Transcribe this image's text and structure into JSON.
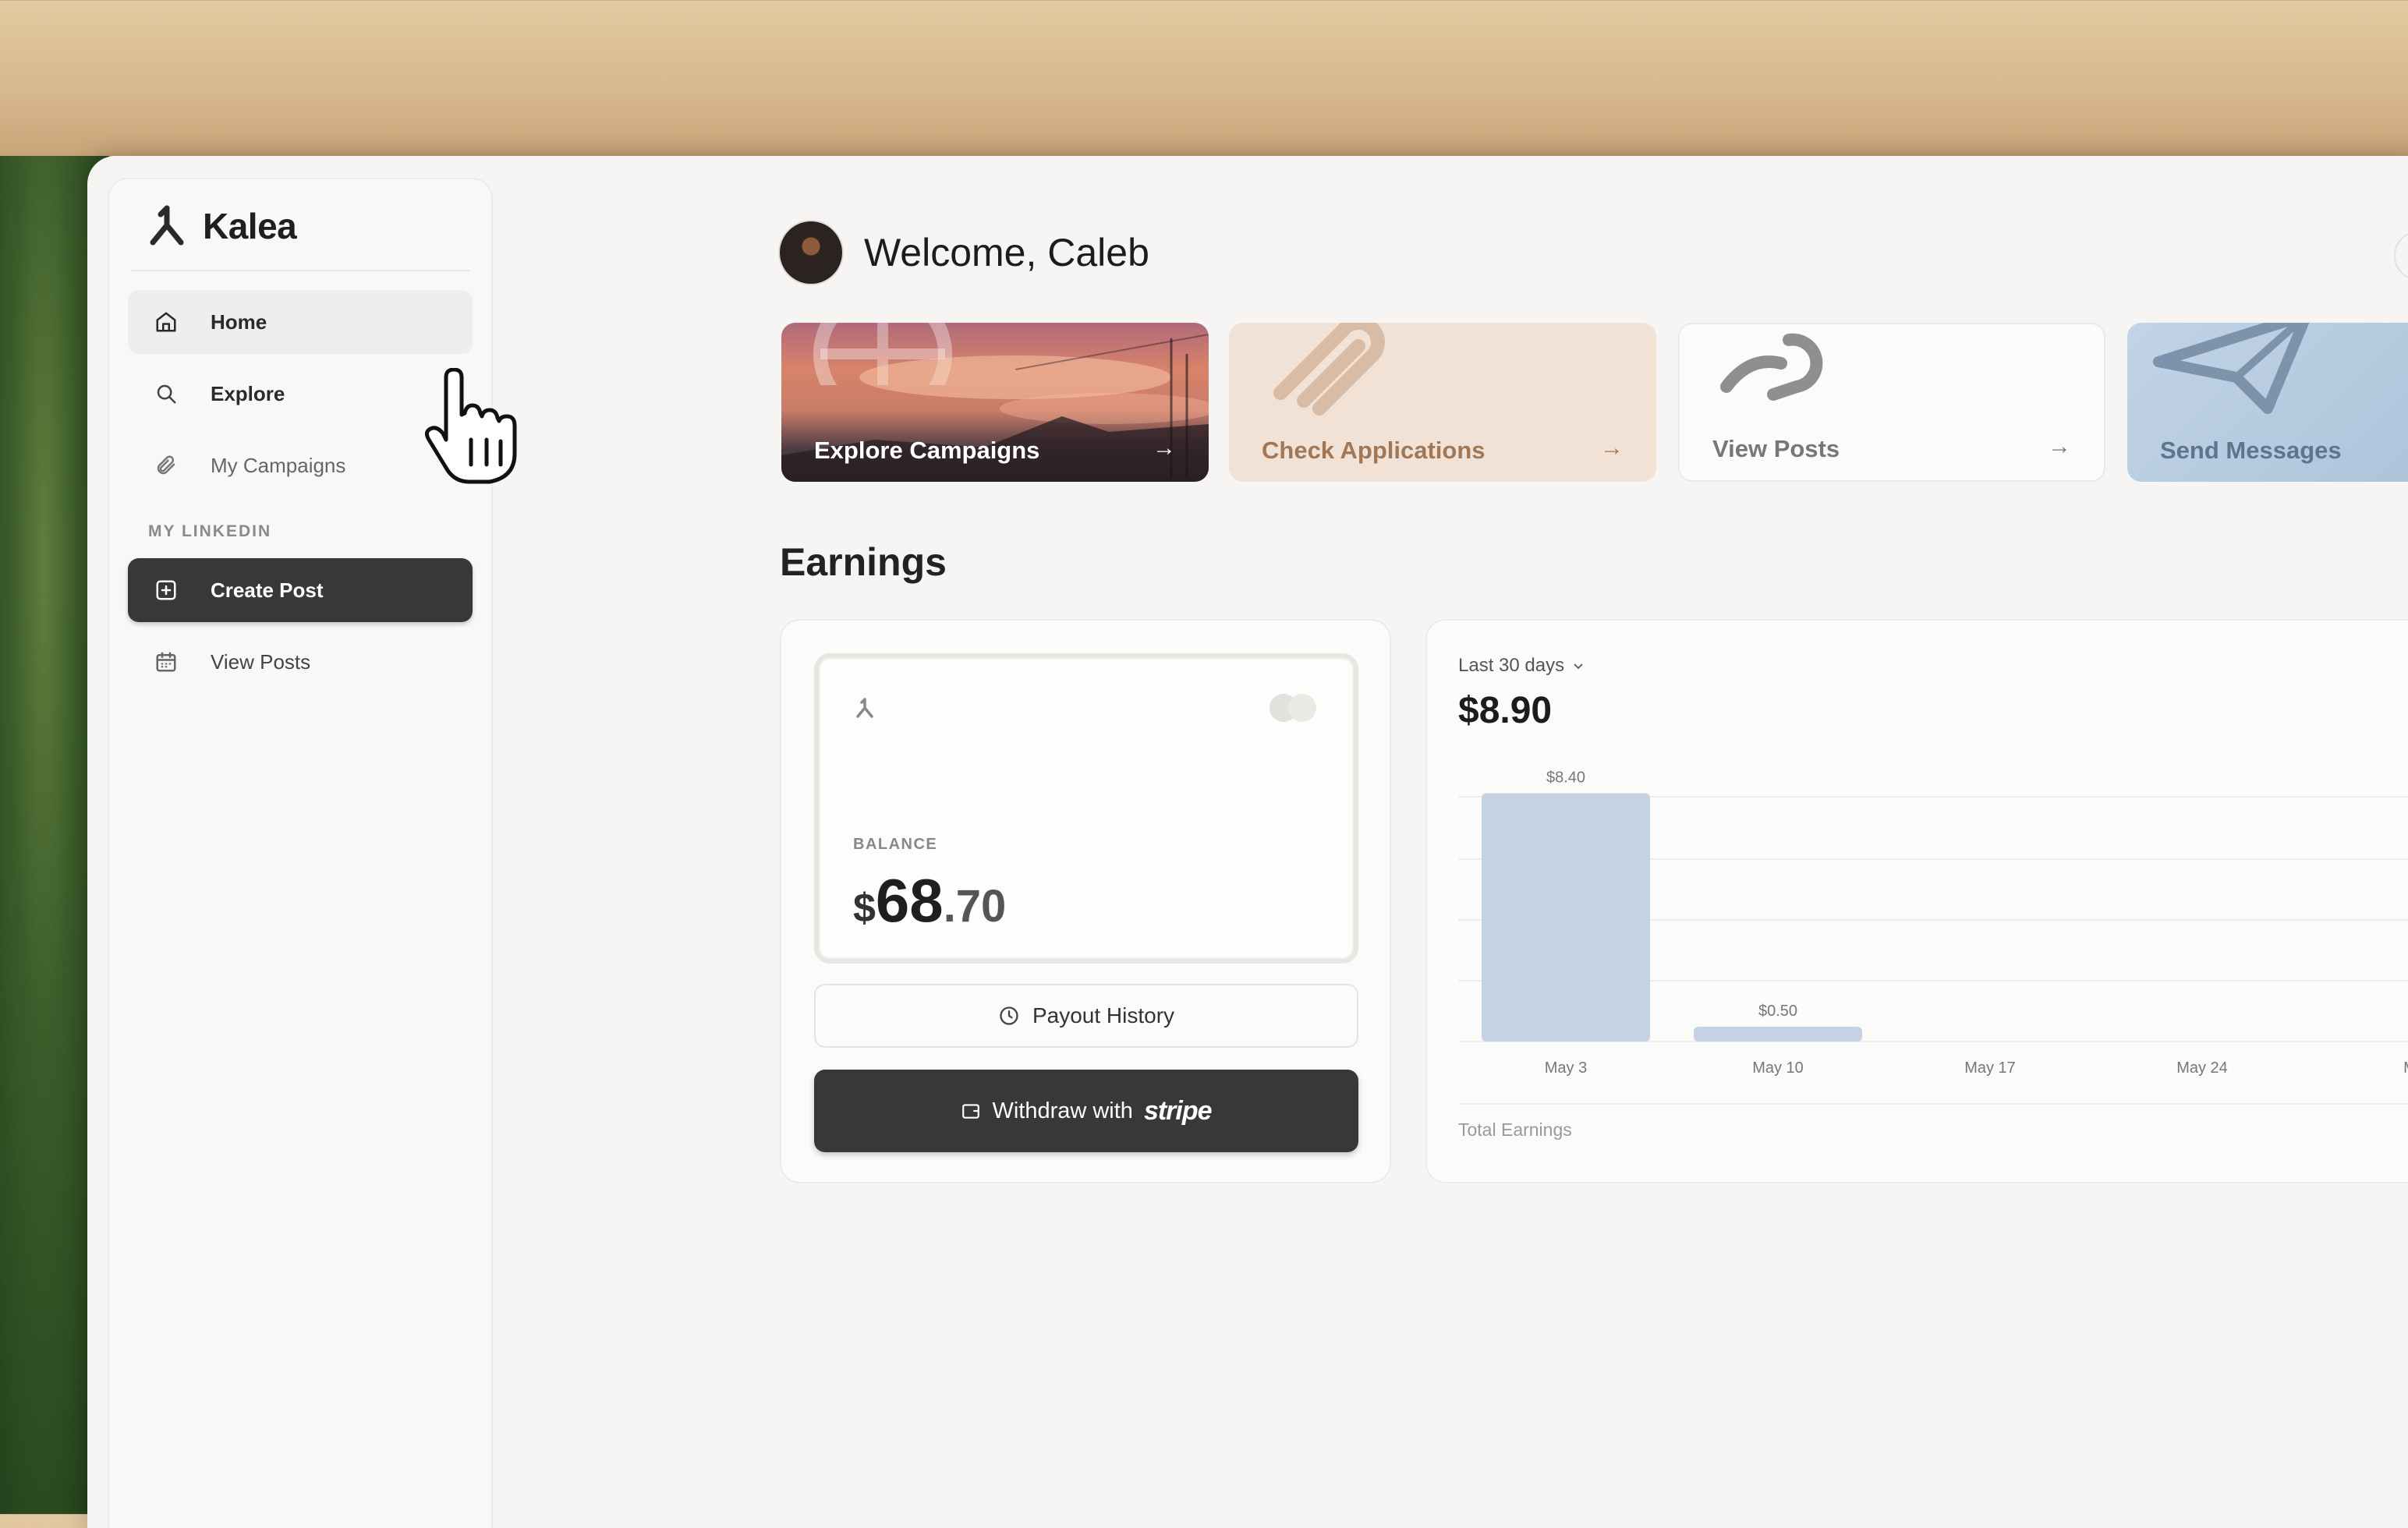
{
  "app": {
    "name": "Kalea"
  },
  "sidebar": {
    "items": [
      {
        "label": "Home",
        "icon": "home-icon"
      },
      {
        "label": "Explore",
        "icon": "search-icon"
      },
      {
        "label": "My Campaigns",
        "icon": "paperclip-icon"
      }
    ],
    "section_label": "MY LINKEDIN",
    "linkedin_items": [
      {
        "label": "Create Post",
        "icon": "plus-square-icon"
      },
      {
        "label": "View Posts",
        "icon": "calendar-icon"
      }
    ]
  },
  "header": {
    "welcome": "Welcome, Caleb"
  },
  "quick_actions": [
    {
      "label": "Explore Campaigns",
      "arrow": "→"
    },
    {
      "label": "Check Applications",
      "arrow": "→"
    },
    {
      "label": "View Posts",
      "arrow": "→"
    },
    {
      "label": "Send Messages"
    }
  ],
  "earnings": {
    "title": "Earnings",
    "balance": {
      "label": "BALANCE",
      "currency": "$",
      "whole": "68",
      "cents": ".70"
    },
    "payout_history_label": "Payout History",
    "withdraw_label": "Withdraw with",
    "withdraw_brand": "stripe",
    "range_label": "Last 30 days",
    "range_total": "$8.90",
    "footer_label": "Total Earnings"
  },
  "chart_data": {
    "type": "bar",
    "categories": [
      "May 3",
      "May 10",
      "May 17",
      "May 24",
      "Ma"
    ],
    "values": [
      8.4,
      0.5,
      0,
      0,
      0
    ],
    "data_labels": [
      "$8.40",
      "$0.50",
      "",
      "",
      ""
    ],
    "ylim": [
      0,
      10
    ],
    "grid": true,
    "bar_color": "#c3d3e4"
  },
  "colors": {
    "accent_dark": "#383838",
    "check_card": "#f2e2d6",
    "send_card": "#b5c9de"
  }
}
